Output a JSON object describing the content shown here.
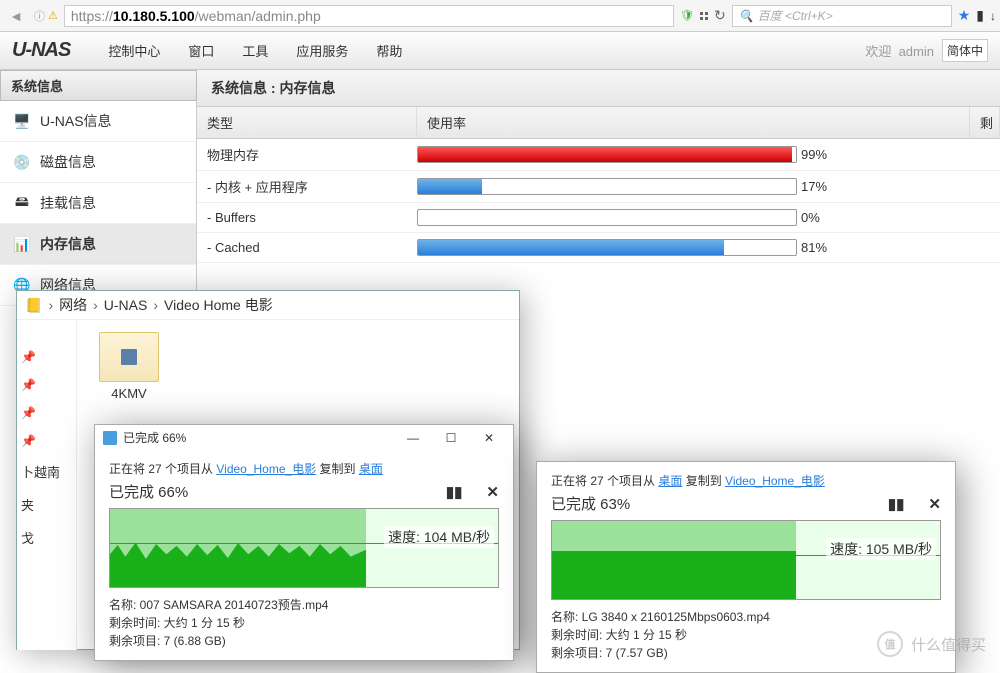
{
  "browser": {
    "url_prefix": "https://",
    "url_host": "10.180.5.100",
    "url_path": "/webman/admin.php",
    "search_placeholder": "百度 <Ctrl+K>"
  },
  "menu": {
    "logo": "U-NAS",
    "items": [
      "控制中心",
      "窗口",
      "工具",
      "应用服务",
      "帮助"
    ],
    "welcome": "欢迎",
    "user": "admin",
    "lang": "简体中"
  },
  "sidebar": {
    "title": "系统信息",
    "items": [
      {
        "label": "U-NAS信息"
      },
      {
        "label": "磁盘信息"
      },
      {
        "label": "挂载信息"
      },
      {
        "label": "内存信息"
      },
      {
        "label": "网络信息"
      }
    ]
  },
  "content": {
    "title": "系统信息 : 内存信息",
    "headers": {
      "type": "类型",
      "usage": "使用率",
      "last": "剩"
    },
    "rows": [
      {
        "label": "物理内存",
        "pct": 99,
        "color": "red"
      },
      {
        "label": "- 内核 + 应用程序",
        "pct": 17,
        "color": "blue"
      },
      {
        "label": "- Buffers",
        "pct": 0,
        "color": "blue"
      },
      {
        "label": "- Cached",
        "pct": 81,
        "color": "blue"
      }
    ]
  },
  "explorer": {
    "breadcrumb": [
      "网络",
      "U-NAS",
      "Video Home 电影"
    ],
    "folder": "4KMV",
    "side_texts": [
      "卜越南",
      "夹",
      "戈"
    ]
  },
  "copy1": {
    "title": "已完成 66%",
    "info_pre": "正在将 27 个项目从 ",
    "info_src": "Video_Home_电影",
    "info_mid": " 复制到 ",
    "info_dst": "桌面",
    "pct_text": "已完成 66%",
    "speed": "速度: 104 MB/秒",
    "name_label": "名称: ",
    "name": "007 SAMSARA 20140723预告.mp4",
    "time_label": "剩余时间: ",
    "time": "大约 1 分 15 秒",
    "remain_label": "剩余项目: ",
    "remain": "7 (6.88 GB)"
  },
  "copy2": {
    "info_pre": "正在将 27 个项目从 ",
    "info_src": "桌面",
    "info_mid": " 复制到 ",
    "info_dst": "Video_Home_电影",
    "pct_text": "已完成 63%",
    "speed": "速度: 105 MB/秒",
    "name_label": "名称: ",
    "name": "LG 3840 x 2160125Mbps0603.mp4",
    "time_label": "剩余时间: ",
    "time": "大约 1 分 15 秒",
    "remain_label": "剩余项目: ",
    "remain": "7 (7.57 GB)"
  },
  "watermark": "什么值得买"
}
